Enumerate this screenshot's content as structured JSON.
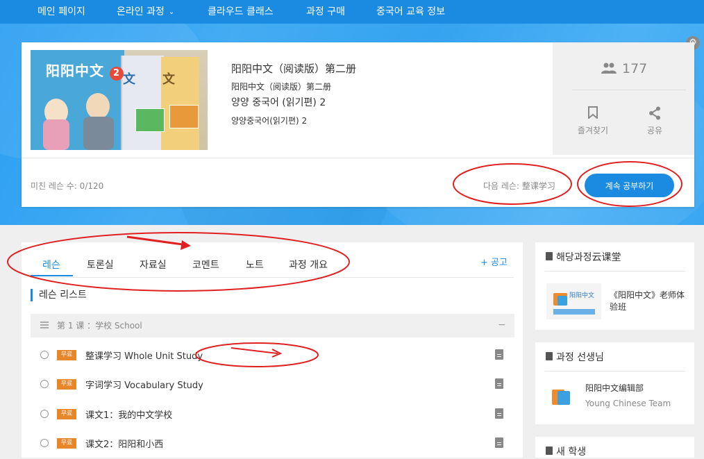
{
  "nav": {
    "items": [
      {
        "label": "메인 페이지"
      },
      {
        "label": "온라인 과정",
        "dropdown": true
      },
      {
        "label": "클라우드 클래스"
      },
      {
        "label": "과정 구매"
      },
      {
        "label": "중국어 교육 정보"
      }
    ],
    "dropdown_glyph": "»"
  },
  "course": {
    "title": "阳阳中文（阅读版）第二册",
    "subtitle": "阳阳中文（阅读版）第二册",
    "title_ko": "양양 중국어 (읽기편) 2",
    "subtitle_ko": "양양중국어(읽기편) 2",
    "thumbnail": {
      "text_main": "阳阳中文",
      "text_vol": "2",
      "text_b2": "文",
      "text_b3": "文"
    },
    "student_count": "177",
    "favorite_label": "즐겨찾기",
    "share_label": "공유",
    "progress_text": "미친 레슨 수: 0/120",
    "next_lesson_text": "다음 레슨: 整课学习",
    "continue_label": "계속 공부하기"
  },
  "tabs": [
    {
      "label": "레슨",
      "active": true
    },
    {
      "label": "토론실"
    },
    {
      "label": "자료실"
    },
    {
      "label": "코멘트"
    },
    {
      "label": "노트"
    },
    {
      "label": "과정 개요"
    }
  ],
  "notice_label": "+ 공고",
  "lesson_list": {
    "section_title": "레슨 리스트",
    "chapter": "第 1 课 ：学校 School",
    "collapse_glyph": "−",
    "badge": "무료",
    "lessons": [
      {
        "title": "整课学习 Whole Unit Study"
      },
      {
        "title": "字词学习 Vocabulary Study"
      },
      {
        "title": "课文1：我的中文学校"
      },
      {
        "title": "课文2：阳阳和小西"
      }
    ]
  },
  "sidebar": {
    "cloud_class": {
      "title": "해당과정云课堂",
      "item": "《阳阳中文》老师体验班",
      "logo_text": "阳阳中文"
    },
    "teacher": {
      "title": "과정 선생님",
      "name": "阳阳中文编辑部",
      "team": "Young Chinese Team"
    },
    "third": {
      "title": "새 학생"
    }
  },
  "colors": {
    "brand": "#1a8be0",
    "badge": "#e8862a",
    "annotation": "#e02020"
  }
}
